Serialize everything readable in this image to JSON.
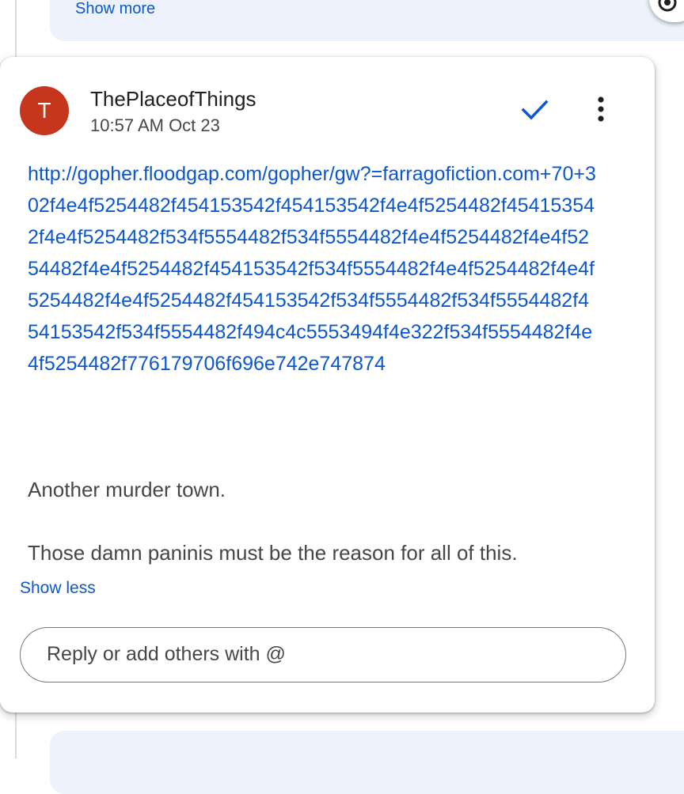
{
  "previous_comment": {
    "show_more_label": "Show more"
  },
  "comment": {
    "avatar_initial": "T",
    "author": "ThePlaceofThings",
    "timestamp": "10:57 AM Oct 23",
    "link": "http://gopher.floodgap.com/gopher/gw?=farragofiction.com+70+302f4e4f5254482f454153542f454153542f4e4f5254482f454153542f4e4f5254482f534f5554482f534f5554482f4e4f5254482f4e4f5254482f4e4f5254482f454153542f534f5554482f4e4f5254482f4e4f5254482f4e4f5254482f454153542f534f5554482f534f5554482f454153542f534f5554482f494c4c5553494f4e322f534f5554482f4e4f5254482f776179706f696e742e747874",
    "paragraphs": [
      "Another murder town.",
      "Those damn paninis must be the reason for all of this."
    ],
    "show_less_label": "Show less",
    "reply_placeholder": "Reply or add others with @"
  },
  "icons": {
    "resolve": "checkmark-icon",
    "more": "more-vert-icon"
  },
  "colors": {
    "link": "#0b57d0",
    "avatar_bg": "#c5361c",
    "card_tint": "#edf2fc"
  }
}
